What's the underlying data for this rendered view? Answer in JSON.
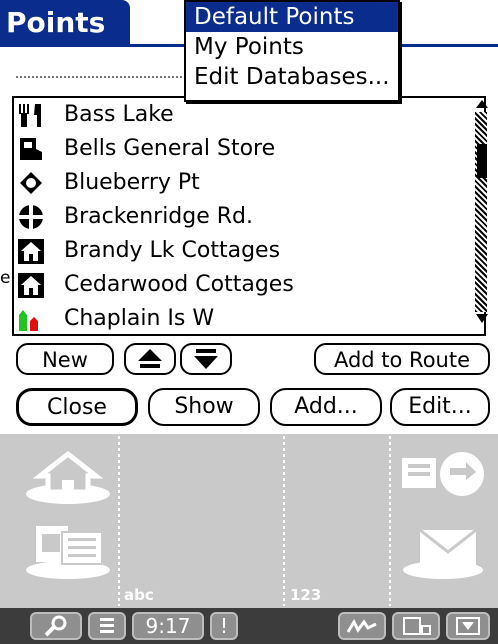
{
  "app": {
    "title": "Points"
  },
  "menu": {
    "items": [
      {
        "label": "Default Points",
        "selected": true
      },
      {
        "label": "My Points",
        "selected": false
      },
      {
        "label": "Edit Databases...",
        "selected": false
      }
    ]
  },
  "list": {
    "items": [
      {
        "label": "Bass Lake",
        "icon": "restaurant-icon"
      },
      {
        "label": "Bells General Store",
        "icon": "store-icon"
      },
      {
        "label": "Blueberry Pt",
        "icon": "waypoint-icon"
      },
      {
        "label": "Brackenridge Rd.",
        "icon": "crossroads-icon"
      },
      {
        "label": "Brandy Lk Cottages",
        "icon": "cottage-icon"
      },
      {
        "label": "Cedarwood Cottages",
        "icon": "cottage-icon"
      },
      {
        "label": "Chaplain Is W",
        "icon": "buoy-icon"
      }
    ],
    "left_fragment": "e"
  },
  "buttons": {
    "new": "New",
    "add_to_route": "Add to Route",
    "close": "Close",
    "show": "Show",
    "add": "Add...",
    "edit": "Edit..."
  },
  "silkscreen": {
    "abc": "abc",
    "num": "123"
  },
  "status": {
    "time": "9:17",
    "alert": "!"
  }
}
